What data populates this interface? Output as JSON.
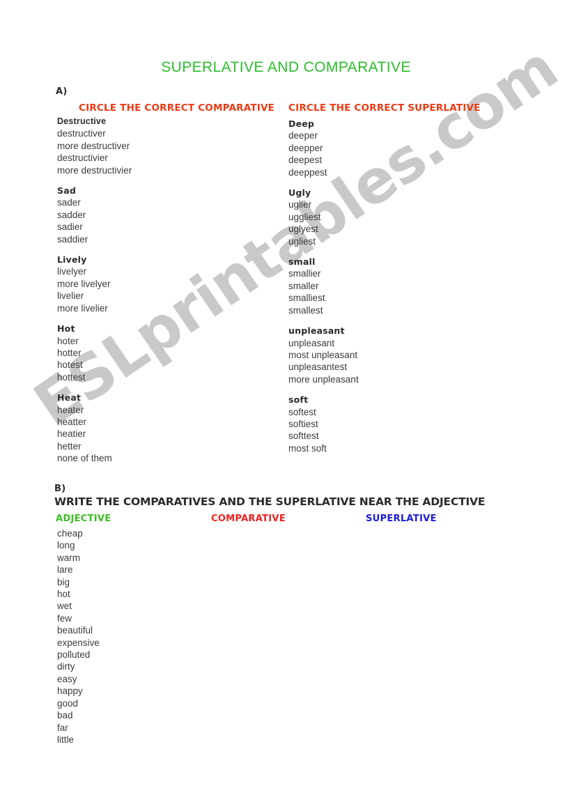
{
  "document": {
    "title": "SUPERLATIVE AND COMPARATIVE",
    "watermark": "ESLprintables.com"
  },
  "colors": {
    "title_green": "#2abd2a",
    "heading_red": "#ef3913",
    "adjective_green": "#3cbf23",
    "comparative_red": "#f42020",
    "superlative_blue": "#1a1ae0",
    "body_text": "#3c3c3c",
    "watermark_gray": "#c9c9c9",
    "page_background": "#ffffff"
  },
  "section_a": {
    "letter": "A)",
    "left_heading": "CIRCLE THE CORRECT COMPARATIVE",
    "right_heading": "CIRCLE THE CORRECT SUPERLATIVE",
    "left_groups": [
      {
        "word": "Destructive",
        "style": "plain",
        "options": [
          "destructiver",
          "more destructiver",
          "destructivier",
          "more destructivier"
        ]
      },
      {
        "word": "Sad",
        "style": "display",
        "options": [
          "sader",
          "sadder",
          "sadier",
          "saddier"
        ]
      },
      {
        "word": "Lively",
        "style": "display",
        "options": [
          "livelyer",
          "more livelyer",
          "livelier",
          "more livelier"
        ]
      },
      {
        "word": "Hot",
        "style": "display",
        "options": [
          "hoter",
          "hotter",
          "hotest",
          "hottest"
        ]
      },
      {
        "word": "Heat",
        "style": "display",
        "options": [
          "heater",
          "heatter",
          "heatier",
          "hetter",
          "none of them"
        ]
      }
    ],
    "right_groups": [
      {
        "word": "Deep",
        "style": "display",
        "options": [
          "deeper",
          "deepper",
          "deepest",
          "deeppest"
        ]
      },
      {
        "word": "Ugly",
        "style": "display",
        "options": [
          "uglier",
          "uggliest",
          "uglyest",
          "ugliest"
        ]
      },
      {
        "word": "small",
        "style": "display",
        "options": [
          "smallier",
          "smaller",
          "smalliest",
          "smallest"
        ]
      },
      {
        "word": "unpleasant",
        "style": "display",
        "options": [
          "unpleasant",
          "most unpleasant",
          "unpleasantest",
          "more unpleasant"
        ]
      },
      {
        "word": "soft",
        "style": "display",
        "options": [
          "softest",
          "softiest",
          "softtest",
          "most soft"
        ]
      }
    ]
  },
  "section_b": {
    "letter": "B)",
    "instruction": "WRITE THE COMPARATIVES AND THE SUPERLATIVE NEAR THE ADJECTIVE",
    "columns": {
      "adjective": "ADJECTIVE",
      "comparative": "COMPARATIVE",
      "superlative": "SUPERLATIVE"
    },
    "adjectives": [
      "cheap",
      "long",
      "warm",
      "lare",
      "big",
      "hot",
      "wet",
      "few",
      "beautiful",
      "expensive",
      "polluted",
      "dirty",
      "easy",
      "happy",
      "good",
      "bad",
      "far",
      "little"
    ]
  }
}
